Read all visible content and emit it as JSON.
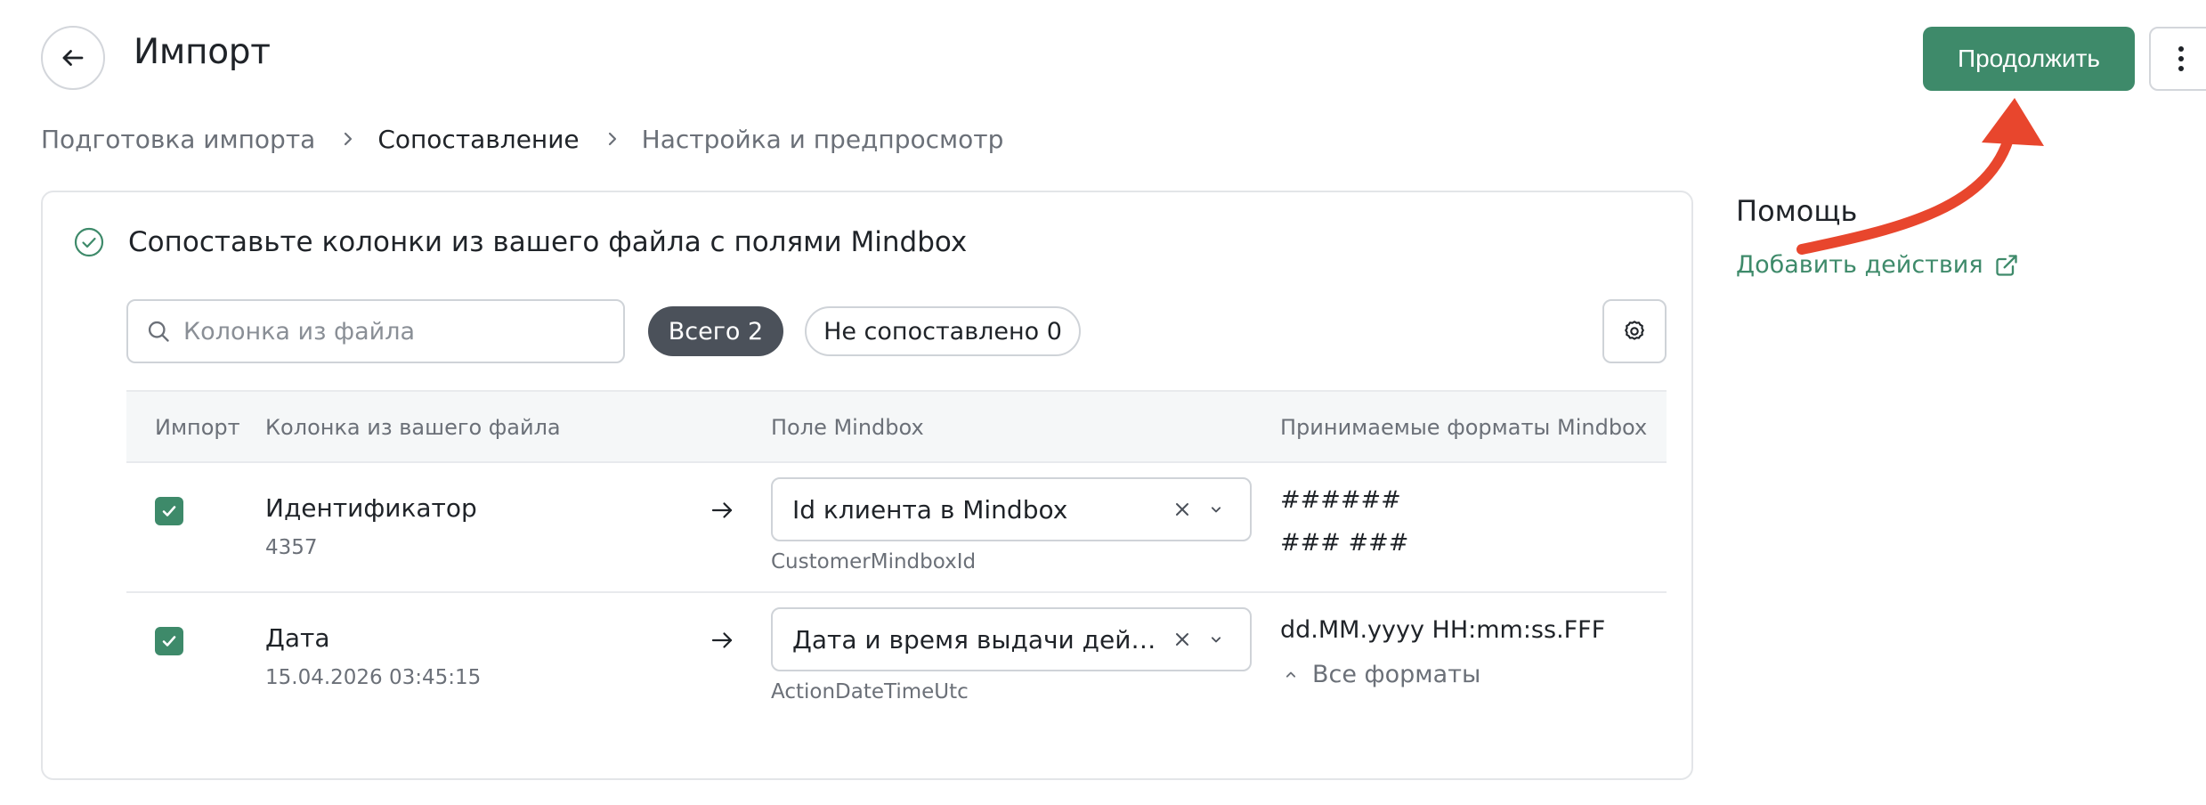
{
  "header": {
    "title": "Импорт",
    "continue_label": "Продолжить"
  },
  "breadcrumb": {
    "steps": [
      "Подготовка импорта",
      "Сопоставление",
      "Настройка и предпросмотр"
    ],
    "active_index": 1
  },
  "mapping": {
    "title": "Сопоставьте колонки из вашего файла с полями Mindbox",
    "search_placeholder": "Колонка из файла",
    "filter_total": "Всего 2",
    "filter_unmatched": "Не сопоставлено 0",
    "columns": [
      "Импорт",
      "Колонка из вашего файла",
      "Поле Mindbox",
      "Принимаемые форматы Mindbox"
    ],
    "rows": [
      {
        "checked": true,
        "name": "Идентификатор",
        "sample": "4357",
        "field": "Id клиента в Mindbox",
        "system_name": "CustomerMindboxId",
        "formats": [
          "######",
          "### ###"
        ]
      },
      {
        "checked": true,
        "name": "Дата",
        "sample": "15.04.2026 03:45:15",
        "field": "Дата и время выдачи дейс...",
        "system_name": "ActionDateTimeUtc",
        "formats": [
          "dd.MM.yyyy HH:mm:ss.FFF"
        ],
        "all_formats_label": "Все форматы"
      }
    ]
  },
  "help": {
    "title": "Помощь",
    "link_label": "Добавить действия"
  },
  "colors": {
    "accent": "#3e8a6a",
    "chip_active": "#4b515a",
    "annotation": "#e8462d"
  },
  "icons": [
    "arrow-left-icon",
    "kebab-icon",
    "chevron-right-icon",
    "check-circle-icon",
    "search-icon",
    "gear-icon",
    "check-icon",
    "arrow-right-icon",
    "close-icon",
    "chevron-down-icon",
    "chevron-up-icon",
    "external-link-icon"
  ]
}
